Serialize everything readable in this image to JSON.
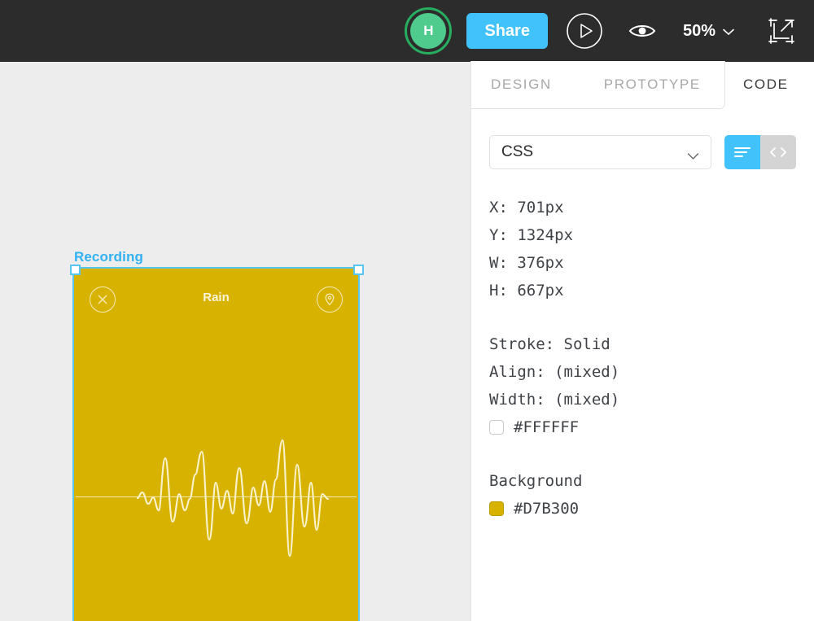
{
  "toolbar": {
    "avatar_initial": "H",
    "avatar_name": "avatar",
    "share_label": "Share",
    "present_icon": "play-circle-icon",
    "view_icon": "eye-icon",
    "zoom_level": "50%",
    "zoom_chevron_icon": "chevron-down-icon",
    "export_icon": "export-icon",
    "bg_color": "#2c2c2c",
    "accent_blue": "#41c2fb",
    "avatar_green": "#4ecb8d"
  },
  "canvas": {
    "background_color": "#ededed",
    "layer_label": "Recording",
    "selection_color": "#58c6ef",
    "artboard": {
      "fill_color": "#d7b300",
      "title": "Rain",
      "close_icon": "close-circle-icon",
      "pin_icon": "location-pin-circle-icon",
      "waveform_icon": "audio-waveform",
      "stroke_color": "#f3e9b6"
    }
  },
  "panel": {
    "tabs": [
      {
        "label": "DESIGN",
        "active": false
      },
      {
        "label": "PROTOTYPE",
        "active": false
      },
      {
        "label": "CODE",
        "active": true
      }
    ],
    "language_select": {
      "value": "CSS",
      "chevron_icon": "chevron-down-icon"
    },
    "view_toggle": {
      "list_icon": "list-view-icon",
      "code_icon": "code-view-icon",
      "active": "list",
      "active_color": "#41c2fb",
      "inactive_color": "#d4d4d4"
    },
    "properties": {
      "x": "X: 701px",
      "y": "Y: 1324px",
      "w": "W: 376px",
      "h": "H: 667px",
      "stroke": "Stroke: Solid",
      "align": "Align: (mixed)",
      "width": "Width: (mixed)",
      "stroke_color_label": "#FFFFFF",
      "stroke_color_value": "#FFFFFF",
      "background_heading": "Background",
      "background_color_label": "#D7B300",
      "background_color_value": "#D7B300"
    }
  }
}
